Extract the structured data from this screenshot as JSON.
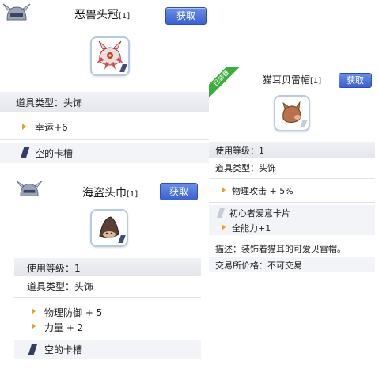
{
  "card1": {
    "title": "恶兽头冠",
    "slots": "[1]",
    "button": "获取",
    "type_line": "道具类型：头饰",
    "stats": [
      "幸运+6"
    ],
    "card_slot": "空的卡槽"
  },
  "card2": {
    "badge": "已装备",
    "title": "猫耳贝雷帽",
    "slots": "[1]",
    "button": "获取",
    "level_line": "使用等级：1",
    "type_line": "道具类型：头饰",
    "stats": [
      "物理攻击 + 5%"
    ],
    "card_name": "初心者爱意卡片",
    "card_stats": [
      "全能力+1"
    ],
    "description": "描述：装饰着猫耳的可爱贝雷帽。",
    "trade": "交易所价格：不可交易"
  },
  "card3": {
    "title": "海盗头巾",
    "slots": "[1]",
    "button": "获取",
    "level_line": "使用等级：1",
    "type_line": "道具类型：头饰",
    "stats": [
      "物理防御 + 5",
      "力量 + 2"
    ],
    "card_slot": "空的卡槽"
  },
  "colors": {
    "button": "#3a62cf",
    "arrow": "#e8a21a",
    "badge": "#3cae3c",
    "slot": "#2f3e66"
  },
  "icons": {
    "header": "helmet-icon",
    "item1": "demon-crown-icon",
    "item2": "cat-beret-icon",
    "item3": "pirate-bandana-icon"
  }
}
